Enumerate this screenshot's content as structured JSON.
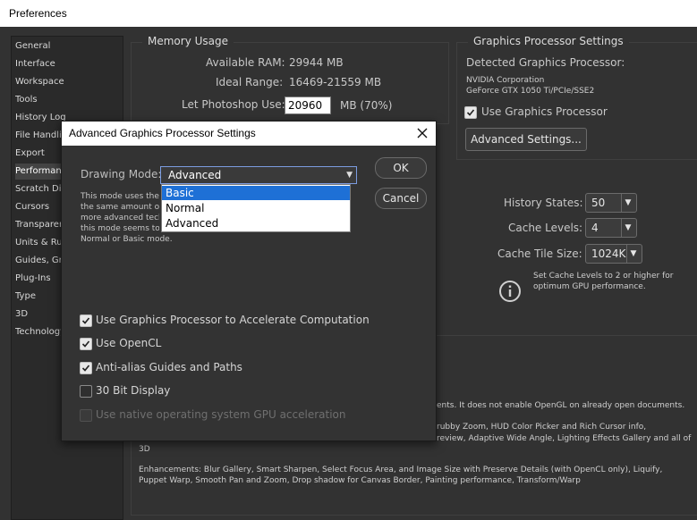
{
  "window": {
    "title": "Preferences"
  },
  "sidebar": {
    "items": [
      {
        "label": "General"
      },
      {
        "label": "Interface"
      },
      {
        "label": "Workspace"
      },
      {
        "label": "Tools"
      },
      {
        "label": "History Log"
      },
      {
        "label": "File Handling"
      },
      {
        "label": "Export"
      },
      {
        "label": "Performance"
      },
      {
        "label": "Scratch Disks"
      },
      {
        "label": "Cursors"
      },
      {
        "label": "Transparency"
      },
      {
        "label": "Units & Rulers"
      },
      {
        "label": "Guides, Grid"
      },
      {
        "label": "Plug-Ins"
      },
      {
        "label": "Type"
      },
      {
        "label": "3D"
      },
      {
        "label": "Technology"
      }
    ],
    "active_index": 7
  },
  "memory": {
    "title": "Memory Usage",
    "available_label": "Available RAM:",
    "available_value": "29944 MB",
    "ideal_label": "Ideal Range:",
    "ideal_value": "16469-21559 MB",
    "let_label": "Let Photoshop Use:",
    "let_value": "20960",
    "let_suffix": "MB (70%)"
  },
  "gpu": {
    "title": "Graphics Processor Settings",
    "detected_label": "Detected Graphics Processor:",
    "vendor": "NVIDIA Corporation",
    "model": "GeForce GTX 1050 Ti/PCIe/SSE2",
    "use_label": "Use Graphics Processor",
    "advanced_button": "Advanced Settings..."
  },
  "history": {
    "states_label": "History States:",
    "states_value": "50",
    "levels_label": "Cache Levels:",
    "levels_value": "4",
    "tile_label": "Cache Tile Size:",
    "tile_value": "1024K",
    "hint_line1": "Set Cache Levels to 2 or higher for",
    "hint_line2": "optimum GPU performance."
  },
  "bg_text": {
    "line1": "ents. It does not enable OpenGL on already open documents.",
    "line2": "rubby Zoom, HUD Color Picker and Rich Cursor info,",
    "line3": "review, Adaptive Wide Angle, Lighting Effects Gallery and all of",
    "line4": "3D",
    "enh1": "Enhancements: Blur Gallery, Smart Sharpen, Select Focus Area, and Image Size with Preserve Details (with OpenCL only), Liquify,",
    "enh2": "Puppet Warp, Smooth Pan and Zoom, Drop shadow for Canvas Border, Painting performance, Transform/Warp"
  },
  "dialog": {
    "title": "Advanced Graphics Processor Settings",
    "drawing_mode_label": "Drawing Mode:",
    "drawing_mode_value": "Advanced",
    "options": [
      "Basic",
      "Normal",
      "Advanced"
    ],
    "highlighted_option": "Basic",
    "desc": [
      "This mode uses the",
      "the same amount of",
      "more advanced tech",
      "this mode seems to",
      "Normal or Basic mode."
    ],
    "ok_button": "OK",
    "cancel_button": "Cancel",
    "checkboxes": [
      {
        "label": "Use Graphics Processor to Accelerate Computation",
        "checked": true,
        "disabled": false
      },
      {
        "label": "Use OpenCL",
        "checked": true,
        "disabled": false
      },
      {
        "label": "Anti-alias Guides and Paths",
        "checked": true,
        "disabled": false
      },
      {
        "label": "30 Bit Display",
        "checked": false,
        "disabled": false
      },
      {
        "label": "Use native operating system GPU acceleration",
        "checked": false,
        "disabled": true
      }
    ]
  }
}
